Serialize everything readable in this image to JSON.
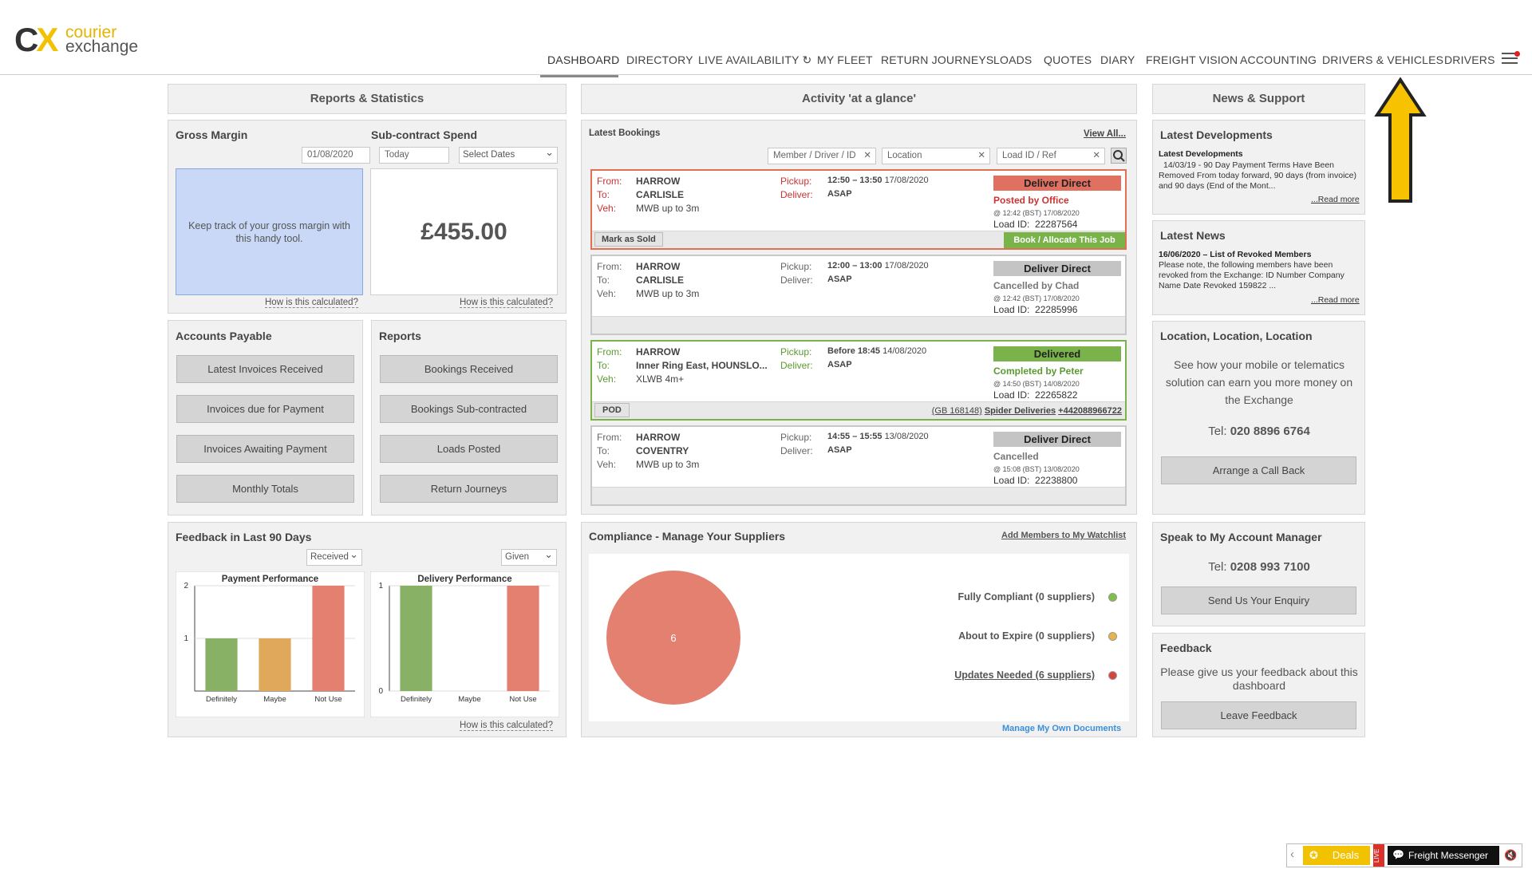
{
  "brand": {
    "mark": "C",
    "mark_x": "X",
    "line1": "courier",
    "line2": "exchange"
  },
  "nav": [
    "DASHBOARD",
    "DIRECTORY",
    "LIVE AVAILABILITY",
    "MY FLEET",
    "RETURN JOURNEYS",
    "LOADS",
    "QUOTES",
    "DIARY",
    "FREIGHT VISION",
    "ACCOUNTING",
    "DRIVERS & VEHICLES",
    "DRIVERS"
  ],
  "nav_refresh_icon": "↻",
  "left": {
    "heading": "Reports & Statistics",
    "gross_margin": {
      "title": "Gross Margin",
      "text": "Keep track of your gross margin with this handy tool.",
      "link": "How is this calculated?"
    },
    "subcontract": {
      "title": "Sub-contract Spend",
      "from": "01/08/2020",
      "to": "Today",
      "select": "Select Dates",
      "amount": "£455.00",
      "link": "How is this calculated?"
    },
    "accounts": {
      "title": "Accounts Payable",
      "buttons": [
        "Latest Invoices Received",
        "Invoices due for Payment",
        "Invoices Awaiting Payment",
        "Monthly Totals"
      ]
    },
    "reports": {
      "title": "Reports",
      "buttons": [
        "Bookings Received",
        "Bookings Sub-contracted",
        "Loads Posted",
        "Return Journeys"
      ]
    },
    "feedback": {
      "title": "Feedback in Last 90 Days",
      "sel1": "Received",
      "sel2": "Given",
      "link": "How is this calculated?"
    }
  },
  "chart_data": [
    {
      "type": "bar",
      "title": "Payment Performance",
      "categories": [
        "Definitely",
        "Maybe",
        "Not Use"
      ],
      "values": [
        1,
        1,
        2
      ],
      "ylim": [
        0,
        2
      ],
      "yticks": [
        "1",
        "2"
      ],
      "colors": [
        "#88b166",
        "#e0a85a",
        "#e38070"
      ]
    },
    {
      "type": "bar",
      "title": "Delivery Performance",
      "categories": [
        "Definitely",
        "Maybe",
        "Not Use"
      ],
      "values": [
        1,
        0,
        1
      ],
      "ylim": [
        0,
        1
      ],
      "yticks": [
        "0",
        "1"
      ],
      "colors": [
        "#88b166",
        "#e0a85a",
        "#e38070"
      ]
    }
  ],
  "center": {
    "heading": "Activity 'at a glance'",
    "bookings_title": "Latest Bookings",
    "view_all": "View All...",
    "filters": [
      "Member / Driver / ID",
      "Location",
      "Load ID / Ref"
    ],
    "labels": {
      "from": "From:",
      "to": "To:",
      "veh": "Veh:",
      "pickup": "Pickup:",
      "deliver": "Deliver:",
      "loadid": "Load ID:"
    },
    "bookings": [
      {
        "from": "HARROW",
        "to": "CARLISLE",
        "veh": "MWB up to 3m",
        "pick_time": "12:50 – 13:50",
        "pick_date": "17/08/2020",
        "deliver": "ASAP",
        "status": "Deliver Direct",
        "sub": "Posted by Office",
        "stamp": "@ 12:42 (BST) 17/08/2020",
        "loadid": "22287564",
        "btn_left": "Mark as Sold",
        "btn_right": "Book / Allocate This Job"
      },
      {
        "from": "HARROW",
        "to": "CARLISLE",
        "veh": "MWB up to 3m",
        "pick_time": "12:00 – 13:00",
        "pick_date": "17/08/2020",
        "deliver": "ASAP",
        "status": "Deliver Direct",
        "sub": "Cancelled by Chad",
        "stamp": "@ 12:42 (BST) 17/08/2020",
        "loadid": "22285996"
      },
      {
        "from": "HARROW",
        "to": "Inner Ring East, HOUNSLO...",
        "veh": "XLWB 4m+",
        "pick_time": "Before 18:45",
        "pick_date": "14/08/2020",
        "deliver": "ASAP",
        "status": "Delivered",
        "sub": "Completed by Peter",
        "stamp": "@ 14:50 (BST) 14/08/2020",
        "loadid": "22265822",
        "btn_left": "POD",
        "gb": "(GB 168148)",
        "company": "Spider Deliveries",
        "phone": "+442088966722"
      },
      {
        "from": "HARROW",
        "to": "COVENTRY",
        "veh": "MWB up to 3m",
        "pick_time": "14:55 – 15:55",
        "pick_date": "13/08/2020",
        "deliver": "ASAP",
        "status": "Deliver Direct",
        "sub": "Cancelled",
        "stamp": "@ 15:08 (BST) 13/08/2020",
        "loadid": "22238800"
      }
    ],
    "compliance": {
      "title": "Compliance - Manage Your Suppliers",
      "watch": "Add Members to My Watchlist",
      "pie_value": "6",
      "legend": [
        "Fully Compliant (0 suppliers)",
        "About to Expire (0 suppliers)",
        "Updates Needed (6 suppliers)"
      ],
      "colors": [
        "#7cc04a",
        "#e8b44a",
        "#d9443a"
      ],
      "manage": "Manage My Own Documents"
    }
  },
  "right": {
    "heading": "News & Support",
    "dev": {
      "title": "Latest Developments",
      "item_title": "Latest Developments",
      "body": "14/03/19 - 90 Day Payment Terms Have Been Removed From today forward, 90 days (from invoice) and 90 days (End of the Mont...",
      "more": "...Read more"
    },
    "news": {
      "title": "Latest News",
      "item_title": "16/06/2020 – List of Revoked Members",
      "body": "Please note, the following members have been revoked from the Exchange: ID Number Company Name Date Revoked 159822 ...",
      "more": "...Read more"
    },
    "location": {
      "title": "Location, Location, Location",
      "text": "See how your mobile or telematics solution can earn you more money on the Exchange",
      "tel_label": "Tel:",
      "tel": "020 8896 6764",
      "button": "Arrange a Call Back"
    },
    "manager": {
      "title": "Speak to My Account Manager",
      "tel_label": "Tel:",
      "tel": "0208 993 7100",
      "button": "Send Us Your Enquiry"
    },
    "feedback": {
      "title": "Feedback",
      "text": "Please give us your feedback about this dashboard",
      "button": "Leave Feedback"
    }
  },
  "widget": {
    "deals": "Deals",
    "live": "LIVE",
    "messenger": "Freight Messenger"
  }
}
